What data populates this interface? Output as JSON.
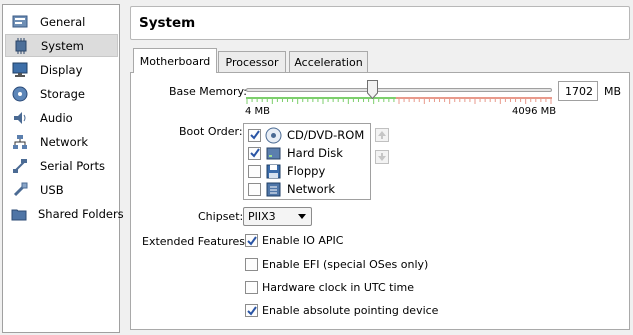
{
  "sidebar": {
    "items": [
      {
        "label": "General",
        "icon": "general-icon"
      },
      {
        "label": "System",
        "icon": "chip-icon"
      },
      {
        "label": "Display",
        "icon": "monitor-icon"
      },
      {
        "label": "Storage",
        "icon": "disk-icon"
      },
      {
        "label": "Audio",
        "icon": "speaker-icon"
      },
      {
        "label": "Network",
        "icon": "network-icon"
      },
      {
        "label": "Serial Ports",
        "icon": "serial-port-icon"
      },
      {
        "label": "USB",
        "icon": "usb-icon"
      },
      {
        "label": "Shared Folders",
        "icon": "folder-icon"
      }
    ],
    "selected": "System"
  },
  "header": {
    "title": "System"
  },
  "tabs": [
    {
      "label": "Motherboard",
      "active": true
    },
    {
      "label": "Processor",
      "active": false
    },
    {
      "label": "Acceleration",
      "active": false
    }
  ],
  "motherboard": {
    "base_memory_label": "Base Memory:",
    "base_memory_value": "1702",
    "base_memory_unit": "MB",
    "slider_min_label": "4 MB",
    "slider_max_label": "4096 MB",
    "slider_fraction": 0.415,
    "boot_order_label": "Boot Order:",
    "boot_items": [
      {
        "label": "CD/DVD-ROM",
        "checked": true,
        "icon": "cd-icon"
      },
      {
        "label": "Hard Disk",
        "checked": true,
        "icon": "hard-disk-icon"
      },
      {
        "label": "Floppy",
        "checked": false,
        "icon": "floppy-icon"
      },
      {
        "label": "Network",
        "checked": false,
        "icon": "network-icon"
      }
    ],
    "chipset_label": "Chipset:",
    "chipset_value": "PIIX3",
    "extended_label": "Extended Features:",
    "features": [
      {
        "label": "Enable IO APIC",
        "checked": true
      },
      {
        "label": "Enable EFI (special OSes only)",
        "checked": false
      },
      {
        "label": "Hardware clock in UTC time",
        "checked": false
      },
      {
        "label": "Enable absolute pointing device",
        "checked": true
      }
    ]
  },
  "colors": {
    "tick_green": "#7ccf6c",
    "tick_red": "#e89a8c",
    "accent": "#3a6fb5"
  }
}
